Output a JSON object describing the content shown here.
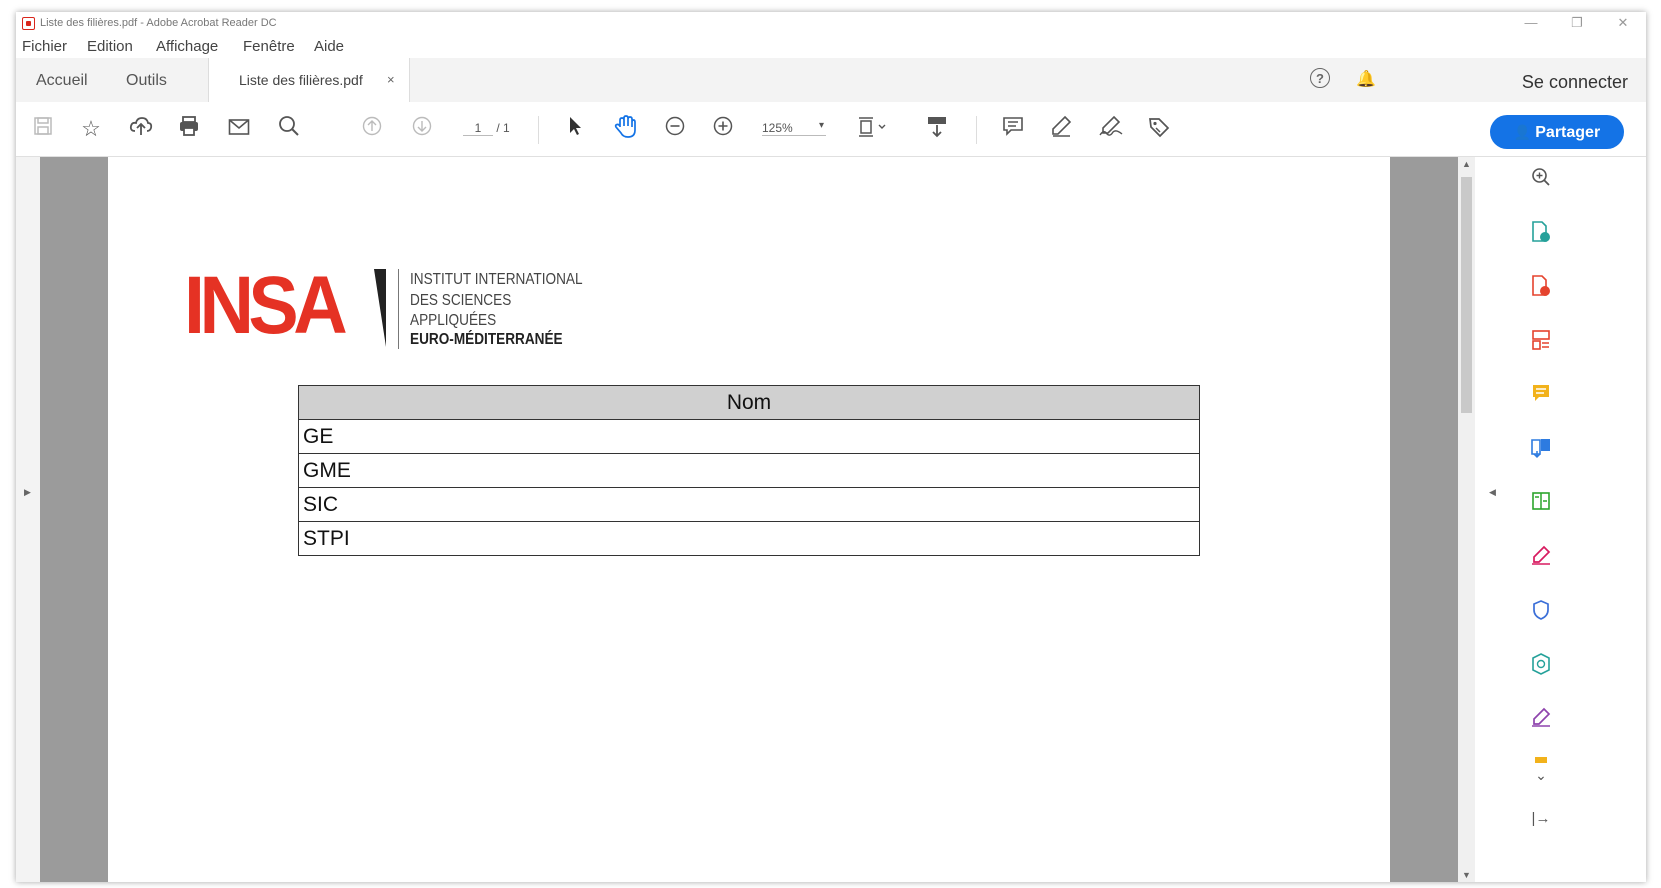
{
  "window": {
    "title": "Liste des filières.pdf - Adobe Acrobat Reader DC",
    "controls": {
      "minimize": "—",
      "restore": "❐",
      "close": "✕"
    }
  },
  "menu": [
    "Fichier",
    "Edition",
    "Affichage",
    "Fenêtre",
    "Aide"
  ],
  "tabs": {
    "home": "Accueil",
    "tools": "Outils",
    "document": "Liste des filières.pdf",
    "close": "×"
  },
  "header": {
    "help": "?",
    "sign_in": "Se connecter"
  },
  "toolbar": {
    "page_current": "1",
    "page_total": "/ 1",
    "zoom": "125%",
    "share": "Partager"
  },
  "document": {
    "logo": {
      "brand": "INSA",
      "lines": [
        "INSTITUT INTERNATIONAL",
        "DES SCIENCES",
        "APPLIQUÉES",
        "EURO-MÉDITERRANÉE"
      ]
    },
    "table": {
      "header": "Nom",
      "rows": [
        "GE",
        "GME",
        "SIC",
        "STPI"
      ]
    }
  },
  "colors": {
    "accent": "#1473e6",
    "insa_red": "#e53224"
  }
}
